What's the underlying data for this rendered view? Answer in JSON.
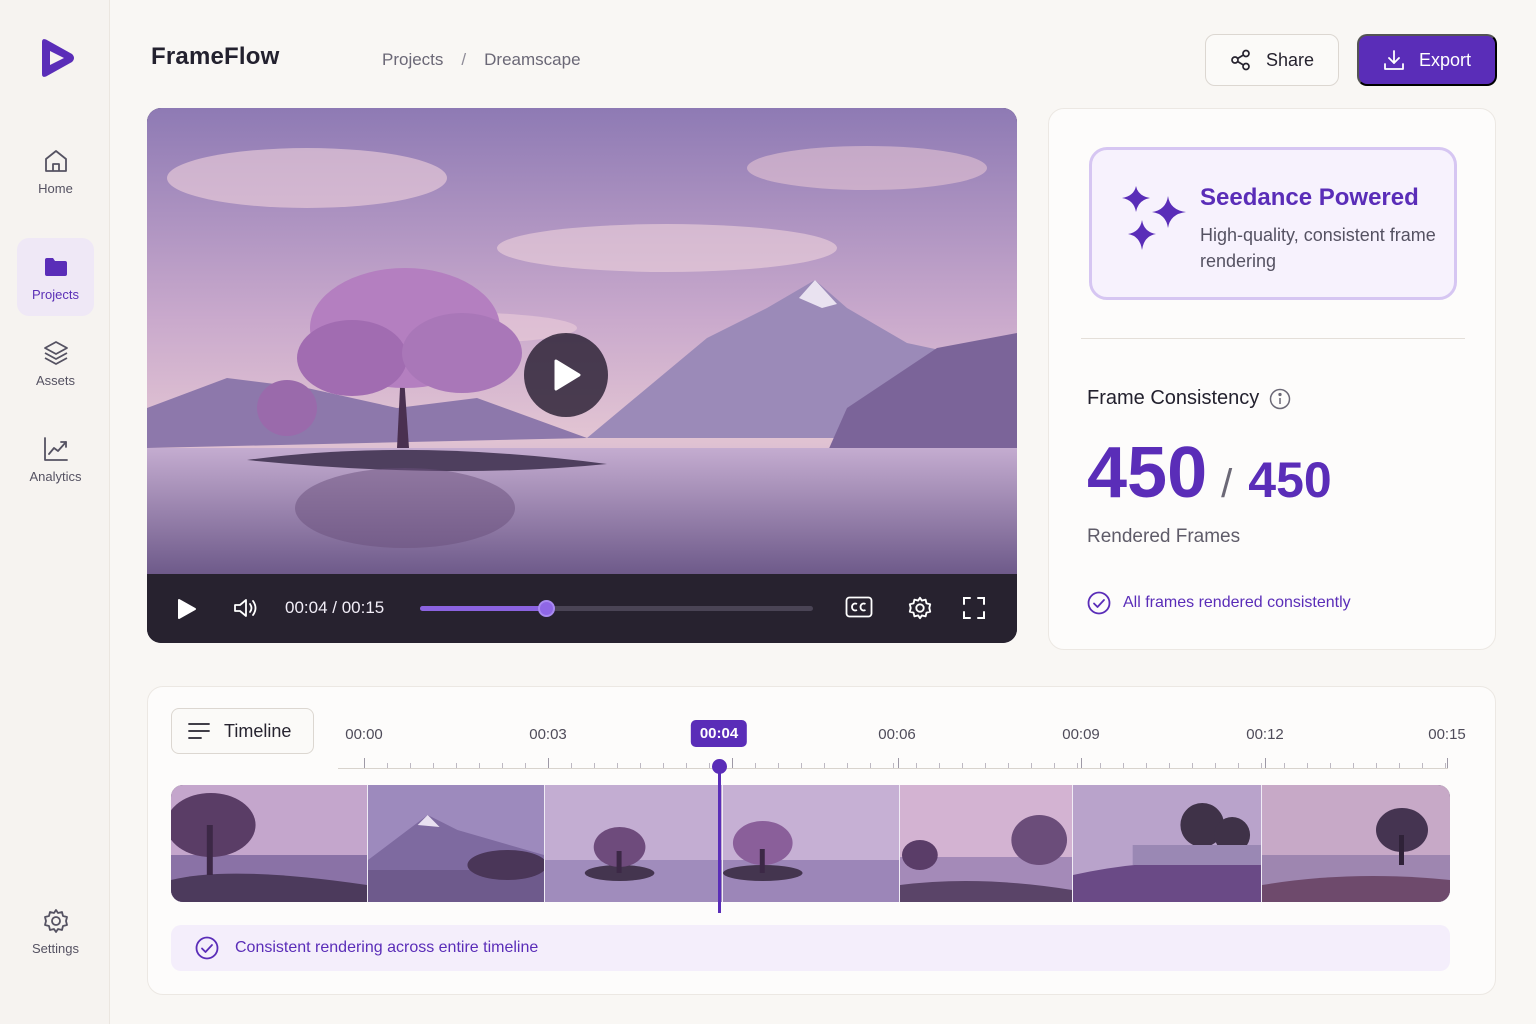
{
  "app": {
    "name": "FrameFlow"
  },
  "sidebar": {
    "items": [
      {
        "label": "Home",
        "icon": "home-icon"
      },
      {
        "label": "Projects",
        "icon": "folder-icon",
        "active": true
      },
      {
        "label": "Assets",
        "icon": "layers-icon"
      },
      {
        "label": "Analytics",
        "icon": "chart-icon"
      }
    ],
    "settings": {
      "label": "Settings",
      "icon": "gear-icon"
    }
  },
  "breadcrumb": {
    "parent": "Projects",
    "separator": "/",
    "current": "Dreamscape"
  },
  "header": {
    "share_label": "Share",
    "export_label": "Export"
  },
  "player": {
    "time_display": "00:04 / 00:15",
    "progress": 0.32,
    "icons": [
      "play-icon",
      "volume-icon",
      "captions-icon",
      "settings-icon",
      "fullscreen-icon"
    ]
  },
  "seedance": {
    "title": "Seedance Powered",
    "description": "High-quality, consistent frame rendering"
  },
  "consistency": {
    "title": "Frame Consistency",
    "rendered": "450",
    "separator": "/",
    "total": "450",
    "subtitle": "Rendered Frames",
    "status": "All frames rendered consistently"
  },
  "timeline": {
    "button_label": "Timeline",
    "ticks": [
      "00:00",
      "00:03",
      "00:04",
      "00:06",
      "00:09",
      "00:12",
      "00:15"
    ],
    "current": "00:04",
    "status": "Consistent rendering across entire timeline"
  },
  "colors": {
    "accent": "#5a2db8",
    "accent_light": "#f4eefb",
    "background": "#f9f7f4"
  }
}
